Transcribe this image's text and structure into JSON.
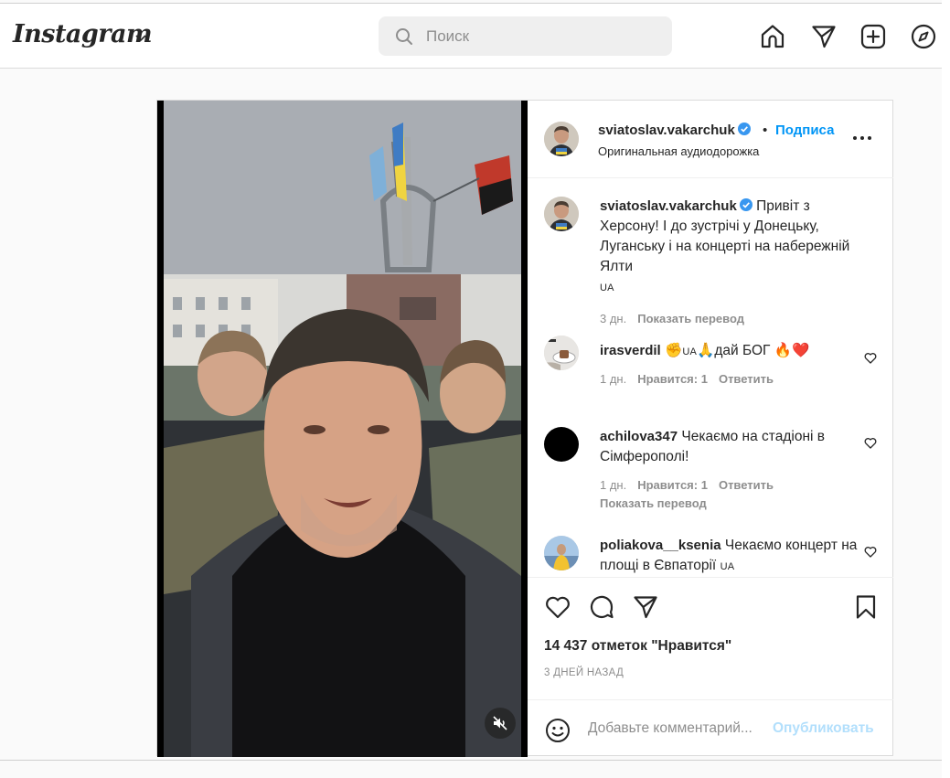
{
  "app": {
    "logo_text": "Instagram"
  },
  "search": {
    "placeholder": "Поиск"
  },
  "nav": {
    "icons": [
      "home-icon",
      "direct-icon",
      "new-post-icon",
      "explore-icon"
    ]
  },
  "post": {
    "author": {
      "username": "sviatoslav.vakarchuk",
      "verified": true,
      "follow_label": "Подписа",
      "separator": "•",
      "audio_label": "Оригинальная аудиодорожка"
    },
    "caption": {
      "username": "sviatoslav.vakarchuk",
      "text": "Привіт з Херсону! І до зустрічі у Донецьку, Луганську і на концерті на набережній Ялти",
      "flag_text": "UA",
      "time": "3 дн.",
      "translate_label": "Показать перевод"
    },
    "comments": [
      {
        "username": "irasverdil",
        "text": "✊🇺🇦🙏дай БОГ 🔥❤️",
        "text_before": "✊",
        "flag": "UA",
        "text_after": "🙏дай БОГ 🔥❤️",
        "time": "1 дн.",
        "likes": "Нравится: 1",
        "reply": "Ответить"
      },
      {
        "username": "achilova347",
        "text": "Чекаємо на стадіоні в Сімферополі!",
        "time": "1 дн.",
        "likes": "Нравится: 1",
        "reply": "Ответить",
        "translate_label": "Показать перевод"
      },
      {
        "username": "poliakova__ksenia",
        "text": "Чекаємо концерт на площі в Євпаторії",
        "flag": "UA"
      }
    ],
    "likes_text": "14 437 отметок \"Нравится\"",
    "date_text": "3 ДНЕЙ НАЗАД",
    "comment_placeholder": "Добавьте комментарий...",
    "publish_label": "Опубликовать"
  },
  "colors": {
    "accent": "#0095f6",
    "publish_disabled": "#b2dffc",
    "verified": "#3897f0"
  }
}
